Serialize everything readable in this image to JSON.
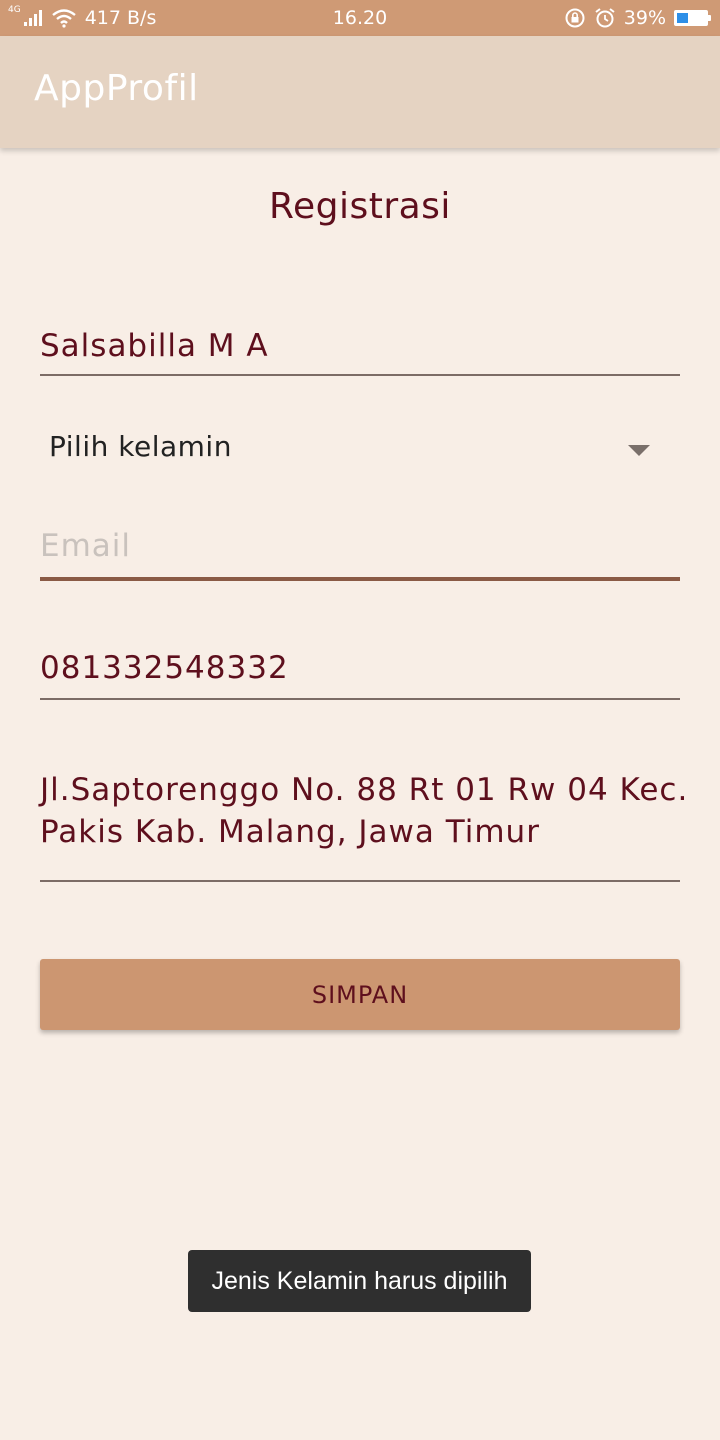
{
  "status_bar": {
    "network_type": "4G",
    "net_speed": "417 B/s",
    "time": "16.20",
    "battery_percent": "39%",
    "battery_level": 0.39,
    "icons": [
      "signal-icon",
      "wifi-icon",
      "rotation-lock-icon",
      "alarm-icon",
      "battery-icon"
    ]
  },
  "app_bar": {
    "title": "AppProfil"
  },
  "page": {
    "title": "Registrasi"
  },
  "form": {
    "name_value": "Salsabilla M A",
    "gender_selected": "Pilih kelamin",
    "email_placeholder": "Email",
    "email_value": "",
    "phone_value": "081332548332",
    "address_line1": "Jl.Saptorenggo No. 88 Rt 01 Rw 04 Kec.",
    "address_line2": "Pakis Kab. Malang, Jawa Timur",
    "save_label": "SIMPAN"
  },
  "toast": {
    "message": "Jenis Kelamin harus dipilih"
  },
  "colors": {
    "status_bar": "#cf9a75",
    "app_bar": "#e5d3c2",
    "background": "#f8eee6",
    "text_primary": "#5e0f1d",
    "button": "#cc9671",
    "toast": "#2f2f2f"
  }
}
